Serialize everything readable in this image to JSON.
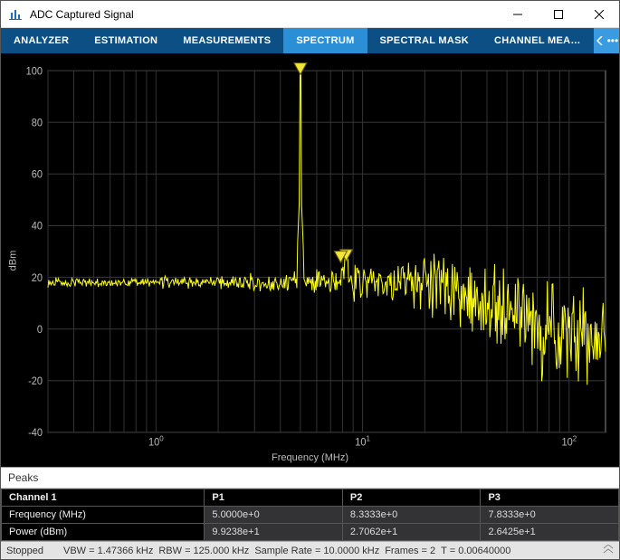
{
  "window": {
    "title": "ADC Captured Signal"
  },
  "toolbar": {
    "tabs": [
      "ANALYZER",
      "ESTIMATION",
      "MEASUREMENTS",
      "SPECTRUM",
      "SPECTRAL MASK",
      "CHANNEL MEA…"
    ],
    "active_index": 3
  },
  "chart_data": {
    "type": "line",
    "xlabel": "Frequency (MHz)",
    "ylabel": "dBm",
    "xscale": "log",
    "xlim": [
      0.3,
      150
    ],
    "ylim": [
      -40,
      100
    ],
    "y_ticks": [
      -40,
      -20,
      0,
      20,
      40,
      60,
      80,
      100
    ],
    "x_ticks": [
      1,
      10,
      100
    ],
    "x_tick_labels": [
      "10^0",
      "10^1",
      "10^2"
    ],
    "series": [
      {
        "name": "Channel 1",
        "color": "#fcfc16"
      }
    ],
    "markers": [
      {
        "name": "P1",
        "x": 5.0,
        "y": 99.238
      },
      {
        "name": "P2",
        "x": 8.3333,
        "y": 27.062
      },
      {
        "name": "P3",
        "x": 7.8333,
        "y": 26.425
      }
    ]
  },
  "peaks": {
    "title": "Peaks",
    "channel_label": "Channel 1",
    "col_labels": [
      "P1",
      "P2",
      "P3"
    ],
    "rows": [
      {
        "label": "Frequency (MHz)",
        "values": [
          "5.0000e+0",
          "8.3333e+0",
          "7.8333e+0"
        ]
      },
      {
        "label": "Power (dBm)",
        "values": [
          "9.9238e+1",
          "2.7062e+1",
          "2.6425e+1"
        ]
      }
    ]
  },
  "status": {
    "state": "Stopped",
    "vbw": "VBW = 1.47366 kHz",
    "rbw": "RBW = 125.000 kHz",
    "sample_rate": "Sample Rate = 10.0000 kHz",
    "frames": "Frames = 2",
    "t": "T = 0.00640000"
  }
}
